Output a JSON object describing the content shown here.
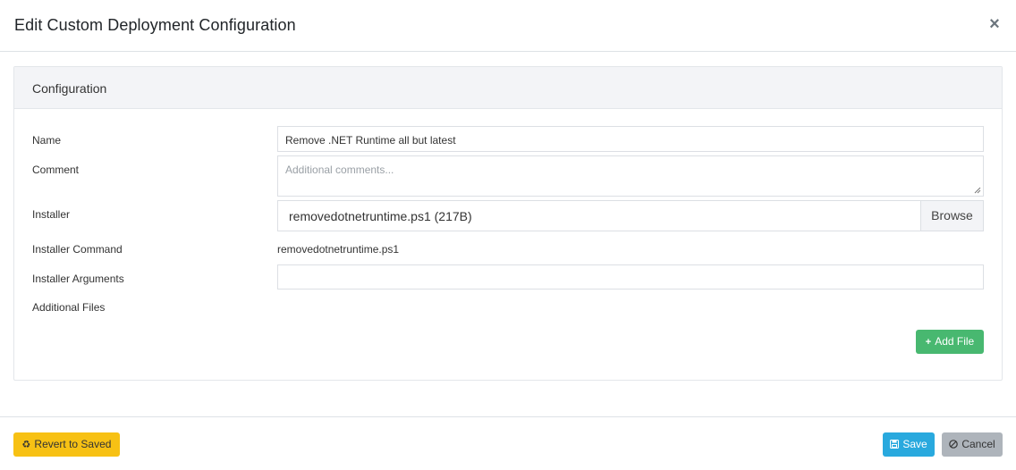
{
  "modal": {
    "title": "Edit Custom Deployment Configuration",
    "close_symbol": "×"
  },
  "card": {
    "title": "Configuration"
  },
  "form": {
    "name_label": "Name",
    "name_value": "Remove .NET Runtime all but latest",
    "comment_label": "Comment",
    "comment_placeholder": "Additional comments...",
    "installer_label": "Installer",
    "installer_file": "removedotnetruntime.ps1 (217B)",
    "browse_label": "Browse",
    "command_label": "Installer Command",
    "command_value": "removedotnetruntime.ps1",
    "arguments_label": "Installer Arguments",
    "arguments_value": "",
    "additional_files_label": "Additional Files",
    "add_file_label": "Add File"
  },
  "footer": {
    "revert_label": "Revert to Saved",
    "save_label": "Save",
    "cancel_label": "Cancel"
  },
  "icons": {
    "plus": "plus-icon",
    "recycle": "recycle-icon",
    "save": "floppy-disk-icon",
    "cancel": "ban-icon",
    "close": "close-icon"
  },
  "colors": {
    "success": "#48b870",
    "warning": "#f7c114",
    "info": "#29a9de",
    "secondary": "#aeb4bb"
  }
}
